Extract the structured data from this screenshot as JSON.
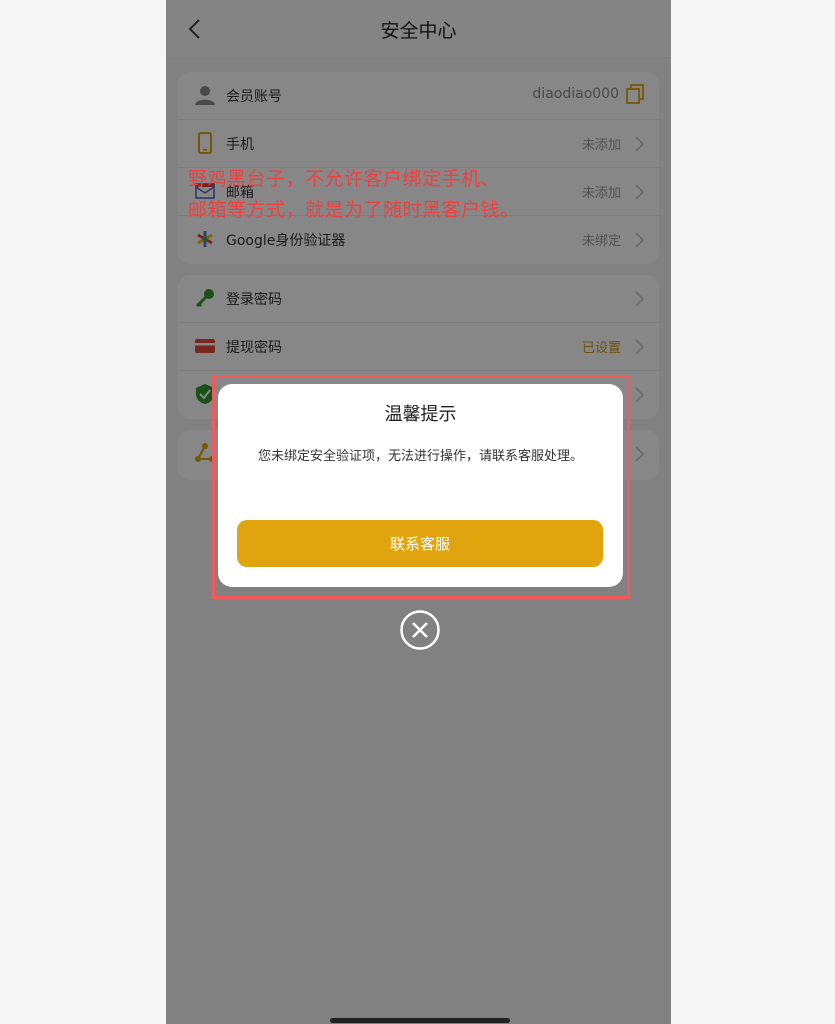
{
  "header": {
    "title": "安全中心"
  },
  "account": {
    "label": "会员账号",
    "value": "diaodiao000"
  },
  "bindings": [
    {
      "label": "手机",
      "status": "未添加"
    },
    {
      "label": "邮箱",
      "status": "未添加"
    },
    {
      "label": "Google身份验证器",
      "status": "未绑定"
    }
  ],
  "passwords": [
    {
      "label": "登录密码",
      "status": ""
    },
    {
      "label": "提现密码",
      "status": "已设置"
    }
  ],
  "annotation": {
    "line1": "野鸡黑台子，不允许客户绑定手机、",
    "line2": "邮箱等方式，就是为了随时黑客户钱。"
  },
  "dialog": {
    "title": "温馨提示",
    "message": "您未绑定安全验证项，无法进行操作，请联系客服处理。",
    "button": "联系客服"
  },
  "colors": {
    "accent": "#e0a40e",
    "annotation": "#f04040",
    "set_status": "#d09a12"
  }
}
